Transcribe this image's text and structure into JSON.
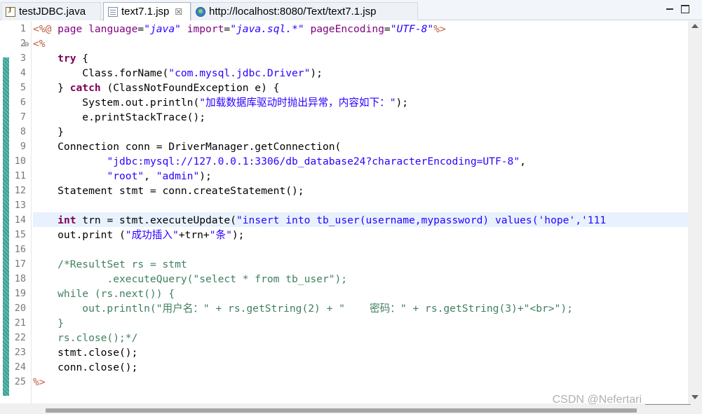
{
  "tabs": [
    {
      "label": "testJDBC.java",
      "icon": "java-file-icon"
    },
    {
      "label": "text7.1.jsp",
      "icon": "jsp-file-icon",
      "close": "☒"
    },
    {
      "label": "http://localhost:8080/Text/text7.1.jsp",
      "icon": "globe-icon"
    }
  ],
  "editor": {
    "line_numbers": [
      "1",
      "2",
      "3",
      "4",
      "5",
      "6",
      "7",
      "8",
      "9",
      "10",
      "11",
      "12",
      "13",
      "14",
      "15",
      "16",
      "17",
      "18",
      "19",
      "20",
      "21",
      "22",
      "23",
      "24",
      "25"
    ],
    "current_line": 14,
    "lines": [
      [
        [
          "dir",
          "<%@ "
        ],
        [
          "attr",
          "page "
        ],
        [
          "attr",
          "language"
        ],
        [
          "plain",
          "="
        ],
        [
          "val",
          "\"java\""
        ],
        [
          "plain",
          " "
        ],
        [
          "attr",
          "import"
        ],
        [
          "plain",
          "="
        ],
        [
          "val",
          "\"java.sql.*\""
        ],
        [
          "plain",
          " "
        ],
        [
          "attr",
          "pageEncoding"
        ],
        [
          "plain",
          "="
        ],
        [
          "val",
          "\"UTF-8\""
        ],
        [
          "dir",
          "%>"
        ]
      ],
      [
        [
          "dir",
          "<%"
        ]
      ],
      [
        [
          "plain",
          "    "
        ],
        [
          "kw",
          "try"
        ],
        [
          "plain",
          " {"
        ]
      ],
      [
        [
          "plain",
          "        Class.forName("
        ],
        [
          "str",
          "\"com.mysql.jdbc.Driver\""
        ],
        [
          "plain",
          ");"
        ]
      ],
      [
        [
          "plain",
          "    } "
        ],
        [
          "kw",
          "catch"
        ],
        [
          "plain",
          " (ClassNotFoundException e) {"
        ]
      ],
      [
        [
          "plain",
          "        System.out.println("
        ],
        [
          "str",
          "\"加载数据库驱动时抛出异常，内容如下：\""
        ],
        [
          "plain",
          ");"
        ]
      ],
      [
        [
          "plain",
          "        e.printStackTrace();"
        ]
      ],
      [
        [
          "plain",
          "    }"
        ]
      ],
      [
        [
          "plain",
          "    Connection conn = DriverManager.getConnection("
        ]
      ],
      [
        [
          "plain",
          "            "
        ],
        [
          "str",
          "\"jdbc:mysql://127.0.0.1:3306/db_database24?characterEncoding=UTF-8\""
        ],
        [
          "plain",
          ","
        ]
      ],
      [
        [
          "plain",
          "            "
        ],
        [
          "str",
          "\"root\""
        ],
        [
          "plain",
          ", "
        ],
        [
          "str",
          "\"admin\""
        ],
        [
          "plain",
          ");"
        ]
      ],
      [
        [
          "plain",
          "    Statement stmt = conn.createStatement();"
        ]
      ],
      [
        [
          "plain",
          ""
        ]
      ],
      [
        [
          "plain",
          "    "
        ],
        [
          "kw",
          "int"
        ],
        [
          "plain",
          " trn = stmt.executeUpdate("
        ],
        [
          "str",
          "\"insert into tb_user(username,mypassword) values('hope','111"
        ]
      ],
      [
        [
          "plain",
          "    out.print ("
        ],
        [
          "str",
          "\"成功插入\""
        ],
        [
          "plain",
          "+trn+"
        ],
        [
          "str",
          "\"条\""
        ],
        [
          "plain",
          ");"
        ]
      ],
      [
        [
          "plain",
          ""
        ]
      ],
      [
        [
          "plain",
          "    "
        ],
        [
          "cmt",
          "/*ResultSet rs = stmt"
        ]
      ],
      [
        [
          "cmt",
          "            .executeQuery(\"select * from tb_user\");"
        ]
      ],
      [
        [
          "cmt",
          "    while (rs.next()) {"
        ]
      ],
      [
        [
          "cmt",
          "        out.println(\"用户名：\" + rs.getString(2) + \"    密码：\" + rs.getString(3)+\"<br>\");"
        ]
      ],
      [
        [
          "cmt",
          "    }"
        ]
      ],
      [
        [
          "cmt",
          "    rs.close();*/"
        ]
      ],
      [
        [
          "plain",
          "    stmt.close();"
        ]
      ],
      [
        [
          "plain",
          "    conn.close();"
        ]
      ],
      [
        [
          "dir",
          "%>"
        ]
      ]
    ]
  },
  "watermark": "CSDN @Nefertari"
}
